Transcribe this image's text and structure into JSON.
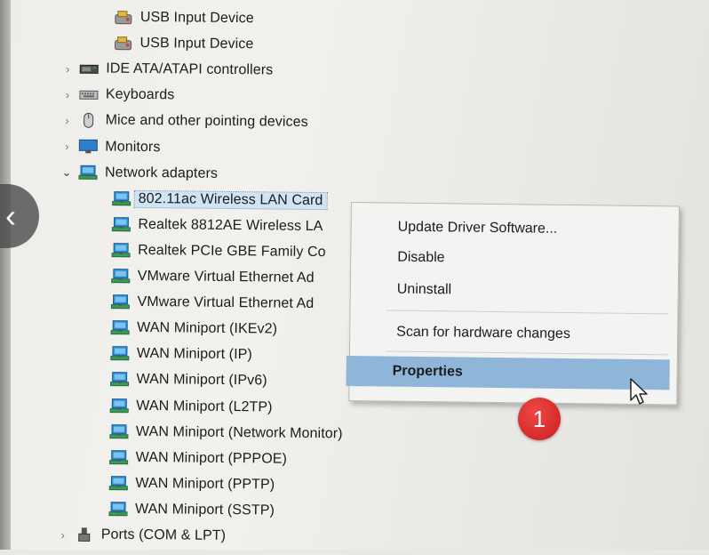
{
  "tree": {
    "items": [
      {
        "label": "USB Input Device",
        "icon": "usb-device-icon",
        "expander": "none",
        "level": 2
      },
      {
        "label": "USB Input Device",
        "icon": "usb-device-icon",
        "expander": "none",
        "level": 2
      },
      {
        "label": "IDE ATA/ATAPI controllers",
        "icon": "ide-controller-icon",
        "expander": "collapsed",
        "level": 1
      },
      {
        "label": "Keyboards",
        "icon": "keyboard-icon",
        "expander": "collapsed",
        "level": 1
      },
      {
        "label": "Mice and other pointing devices",
        "icon": "mouse-icon",
        "expander": "collapsed",
        "level": 1
      },
      {
        "label": "Monitors",
        "icon": "monitor-icon",
        "expander": "collapsed",
        "level": 1
      },
      {
        "label": "Network adapters",
        "icon": "network-adapter-icon",
        "expander": "expanded",
        "level": 1
      },
      {
        "label": "802.11ac Wireless LAN Card",
        "icon": "network-adapter-icon",
        "expander": "none",
        "level": 2,
        "selected": true
      },
      {
        "label": "Realtek 8812AE Wireless LA",
        "icon": "network-adapter-icon",
        "expander": "none",
        "level": 2
      },
      {
        "label": "Realtek PCIe GBE Family Co",
        "icon": "network-adapter-icon",
        "expander": "none",
        "level": 2
      },
      {
        "label": "VMware Virtual Ethernet Ad",
        "icon": "network-adapter-icon",
        "expander": "none",
        "level": 2
      },
      {
        "label": "VMware Virtual Ethernet Ad",
        "icon": "network-adapter-icon",
        "expander": "none",
        "level": 2
      },
      {
        "label": "WAN Miniport (IKEv2)",
        "icon": "network-adapter-icon",
        "expander": "none",
        "level": 2
      },
      {
        "label": "WAN Miniport (IP)",
        "icon": "network-adapter-icon",
        "expander": "none",
        "level": 2
      },
      {
        "label": "WAN Miniport (IPv6)",
        "icon": "network-adapter-icon",
        "expander": "none",
        "level": 2
      },
      {
        "label": "WAN Miniport (L2TP)",
        "icon": "network-adapter-icon",
        "expander": "none",
        "level": 2
      },
      {
        "label": "WAN Miniport (Network Monitor)",
        "icon": "network-adapter-icon",
        "expander": "none",
        "level": 2
      },
      {
        "label": "WAN Miniport (PPPOE)",
        "icon": "network-adapter-icon",
        "expander": "none",
        "level": 2
      },
      {
        "label": "WAN Miniport (PPTP)",
        "icon": "network-adapter-icon",
        "expander": "none",
        "level": 2
      },
      {
        "label": "WAN Miniport (SSTP)",
        "icon": "network-adapter-icon",
        "expander": "none",
        "level": 2
      },
      {
        "label": "Ports (COM & LPT)",
        "icon": "port-icon",
        "expander": "collapsed",
        "level": 1
      }
    ]
  },
  "context_menu": {
    "update_driver": "Update Driver Software...",
    "disable": "Disable",
    "uninstall": "Uninstall",
    "scan": "Scan for hardware changes",
    "properties": "Properties"
  },
  "annotation": {
    "step_number": "1"
  },
  "nav": {
    "prev_glyph": "‹"
  },
  "colors": {
    "selection": "#cfe4f5",
    "menu_highlight": "#8fb5d8",
    "badge": "#d42a2a"
  }
}
